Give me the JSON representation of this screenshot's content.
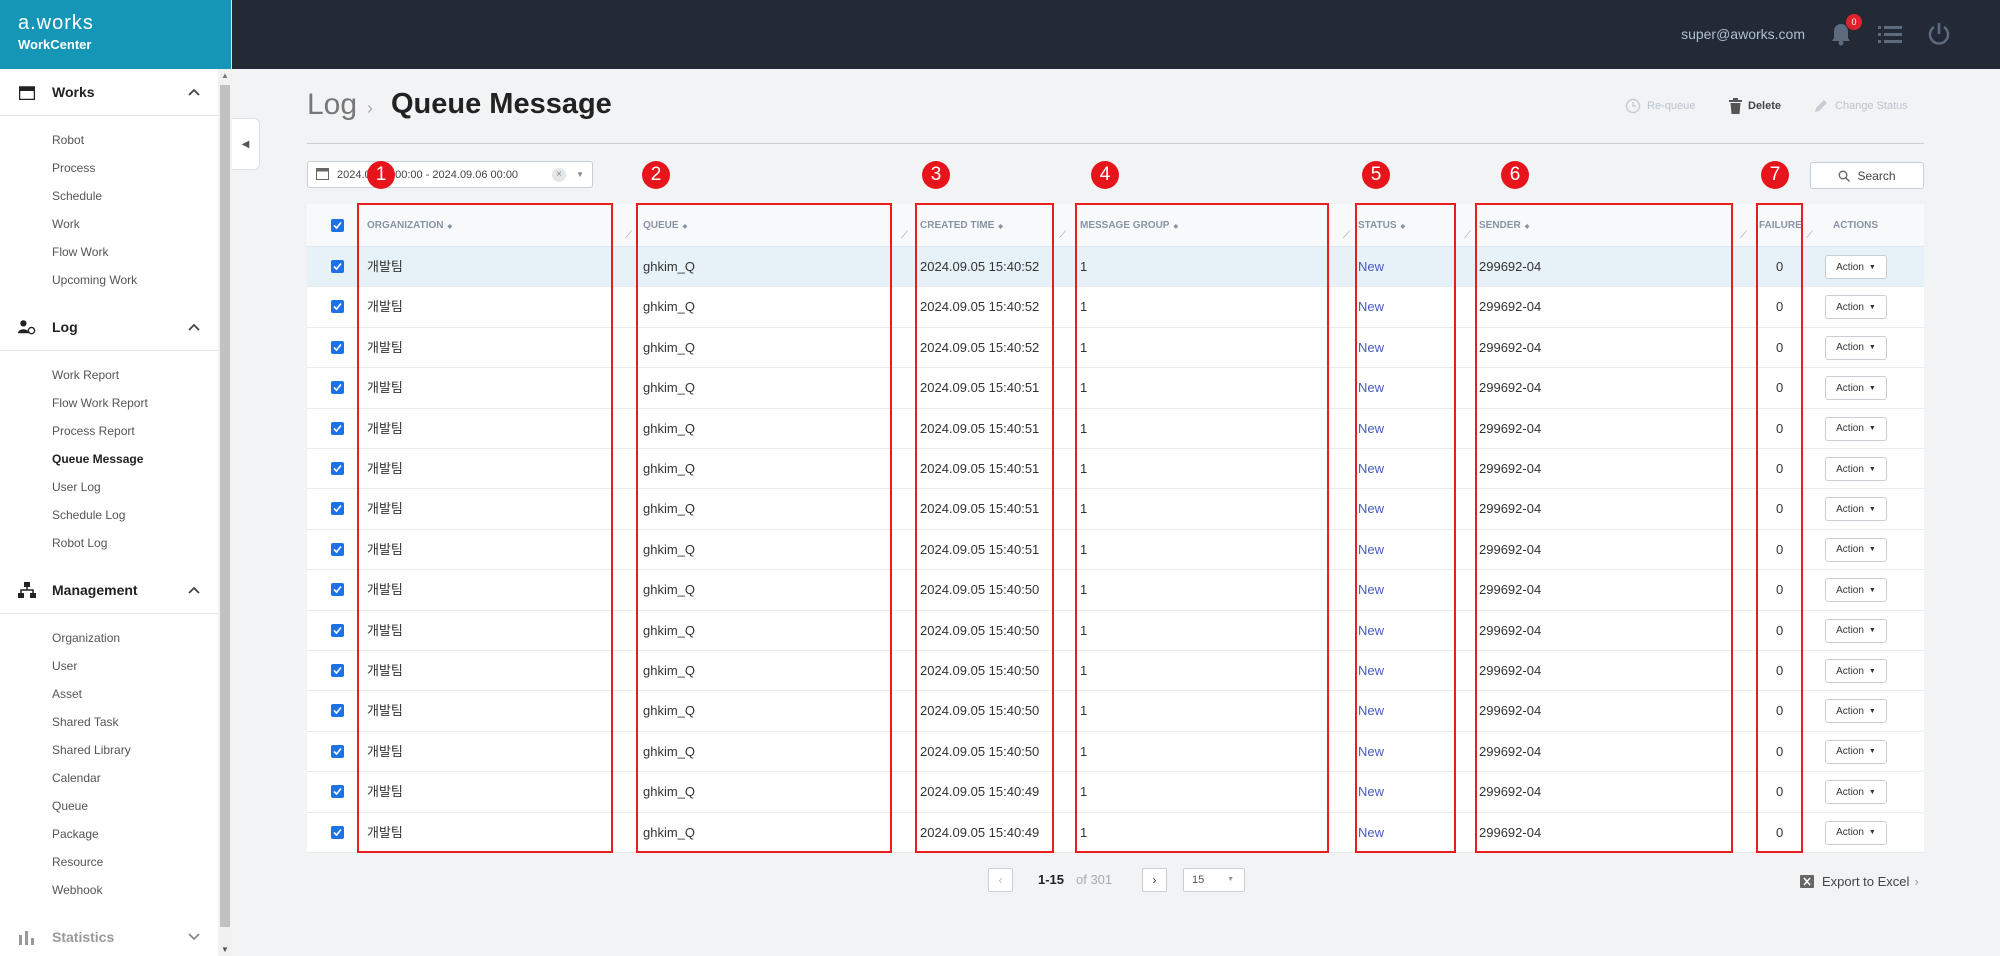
{
  "app": {
    "logo": "a.works",
    "name": "WorkCenter"
  },
  "topbar": {
    "user_email": "super@aworks.com",
    "notification_count": "0"
  },
  "sidebar": {
    "sections": [
      {
        "title": "Works",
        "icon": "calendar-icon",
        "items": [
          "Robot",
          "Process",
          "Schedule",
          "Work",
          "Flow Work",
          "Upcoming Work"
        ]
      },
      {
        "title": "Log",
        "icon": "user-log-icon",
        "items": [
          "Work Report",
          "Flow Work Report",
          "Process Report",
          "Queue Message",
          "User Log",
          "Schedule Log",
          "Robot Log"
        ]
      },
      {
        "title": "Management",
        "icon": "hierarchy-icon",
        "items": [
          "Organization",
          "User",
          "Asset",
          "Shared Task",
          "Shared Library",
          "Calendar",
          "Queue",
          "Package",
          "Resource",
          "Webhook"
        ]
      },
      {
        "title": "Statistics",
        "icon": "bar-chart-icon",
        "items": []
      }
    ],
    "active_item": "Queue Message"
  },
  "breadcrumb": {
    "parent": "Log",
    "current": "Queue Message"
  },
  "toolbar": {
    "requeue": "Re-queue",
    "delete": "Delete",
    "change_status": "Change Status"
  },
  "filter": {
    "date_range": "2024.09.05 00:00 - 2024.09.06 00:00",
    "search_label": "Search"
  },
  "table": {
    "columns": [
      "ORGANIZATION",
      "QUEUE",
      "CREATED TIME",
      "MESSAGE GROUP",
      "STATUS",
      "SENDER",
      "FAILURE",
      "ACTIONS"
    ],
    "action_label": "Action",
    "rows": [
      {
        "org": "개발팀",
        "queue": "ghkim_Q",
        "created": "2024.09.05 15:40:52",
        "group": "1",
        "status": "New",
        "sender": "299692-04",
        "failure": "0"
      },
      {
        "org": "개발팀",
        "queue": "ghkim_Q",
        "created": "2024.09.05 15:40:52",
        "group": "1",
        "status": "New",
        "sender": "299692-04",
        "failure": "0"
      },
      {
        "org": "개발팀",
        "queue": "ghkim_Q",
        "created": "2024.09.05 15:40:52",
        "group": "1",
        "status": "New",
        "sender": "299692-04",
        "failure": "0"
      },
      {
        "org": "개발팀",
        "queue": "ghkim_Q",
        "created": "2024.09.05 15:40:51",
        "group": "1",
        "status": "New",
        "sender": "299692-04",
        "failure": "0"
      },
      {
        "org": "개발팀",
        "queue": "ghkim_Q",
        "created": "2024.09.05 15:40:51",
        "group": "1",
        "status": "New",
        "sender": "299692-04",
        "failure": "0"
      },
      {
        "org": "개발팀",
        "queue": "ghkim_Q",
        "created": "2024.09.05 15:40:51",
        "group": "1",
        "status": "New",
        "sender": "299692-04",
        "failure": "0"
      },
      {
        "org": "개발팀",
        "queue": "ghkim_Q",
        "created": "2024.09.05 15:40:51",
        "group": "1",
        "status": "New",
        "sender": "299692-04",
        "failure": "0"
      },
      {
        "org": "개발팀",
        "queue": "ghkim_Q",
        "created": "2024.09.05 15:40:51",
        "group": "1",
        "status": "New",
        "sender": "299692-04",
        "failure": "0"
      },
      {
        "org": "개발팀",
        "queue": "ghkim_Q",
        "created": "2024.09.05 15:40:50",
        "group": "1",
        "status": "New",
        "sender": "299692-04",
        "failure": "0"
      },
      {
        "org": "개발팀",
        "queue": "ghkim_Q",
        "created": "2024.09.05 15:40:50",
        "group": "1",
        "status": "New",
        "sender": "299692-04",
        "failure": "0"
      },
      {
        "org": "개발팀",
        "queue": "ghkim_Q",
        "created": "2024.09.05 15:40:50",
        "group": "1",
        "status": "New",
        "sender": "299692-04",
        "failure": "0"
      },
      {
        "org": "개발팀",
        "queue": "ghkim_Q",
        "created": "2024.09.05 15:40:50",
        "group": "1",
        "status": "New",
        "sender": "299692-04",
        "failure": "0"
      },
      {
        "org": "개발팀",
        "queue": "ghkim_Q",
        "created": "2024.09.05 15:40:50",
        "group": "1",
        "status": "New",
        "sender": "299692-04",
        "failure": "0"
      },
      {
        "org": "개발팀",
        "queue": "ghkim_Q",
        "created": "2024.09.05 15:40:49",
        "group": "1",
        "status": "New",
        "sender": "299692-04",
        "failure": "0"
      },
      {
        "org": "개발팀",
        "queue": "ghkim_Q",
        "created": "2024.09.05 15:40:49",
        "group": "1",
        "status": "New",
        "sender": "299692-04",
        "failure": "0"
      }
    ]
  },
  "annotations": [
    "1",
    "2",
    "3",
    "4",
    "5",
    "6",
    "7"
  ],
  "pagination": {
    "range": "1-15",
    "of_total": "of 301",
    "page_size": "15"
  },
  "export_label": "Export to Excel",
  "colors": {
    "brand": "#1596b7",
    "topbar": "#232a35",
    "highlight": "#e81d1d",
    "status_new": "#4a5bbf",
    "checkbox": "#1a73e8"
  }
}
